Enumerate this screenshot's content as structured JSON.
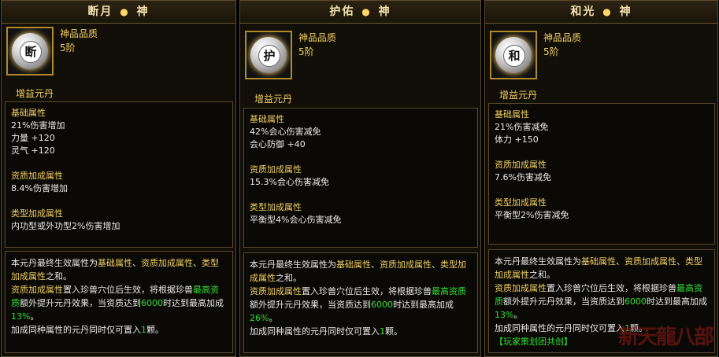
{
  "panels": [
    {
      "title_left": "断月",
      "title_dot": "●",
      "title_right": "神",
      "icon_glyph": "断",
      "quality_label": "神品品质",
      "stage": "5阶",
      "subtitle": "增益元丹",
      "base_header": "基础属性",
      "base_lines": [
        "21%伤害增加",
        "力量 +120",
        "灵气 +120"
      ],
      "aptitude_header": "资质加成属性",
      "aptitude_lines": [
        "8.4%伤害增加"
      ],
      "type_header": "类型加成属性",
      "type_lines": [
        "内功型或外功型2%伤害增加"
      ]
    },
    {
      "title_left": "护佑",
      "title_dot": "●",
      "title_right": "神",
      "icon_glyph": "护",
      "quality_label": "神品品质",
      "stage": "5阶",
      "subtitle": "增益元丹",
      "base_header": "基础属性",
      "base_lines": [
        "42%会心伤害减免",
        "会心防御 +40"
      ],
      "aptitude_header": "资质加成属性",
      "aptitude_lines": [
        "15.3%会心伤害减免"
      ],
      "type_header": "类型加成属性",
      "type_lines": [
        "平衡型4%会心伤害减免"
      ]
    },
    {
      "title_left": "和光",
      "title_dot": "●",
      "title_right": "神",
      "icon_glyph": "和",
      "quality_label": "神品品质",
      "stage": "5阶",
      "subtitle": "增益元丹",
      "base_header": "基础属性",
      "base_lines": [
        "21%伤害减免",
        "体力 +150"
      ],
      "aptitude_header": "资质加成属性",
      "aptitude_lines": [
        "7.6%伤害减免"
      ],
      "type_header": "类型加成属性",
      "type_lines": [
        "平衡型2%伤害减免"
      ]
    }
  ],
  "description": {
    "p1_a": "本元丹最终生效属性为",
    "p1_b": "基础属性",
    "p1_c": "、",
    "p1_d": "资质加成属性",
    "p1_e": "、",
    "p1_f": "类型加成属性",
    "p1_g": "之和。",
    "p2_a": "资质加成属性",
    "p2_b": "置入珍兽穴位后生效，将根据珍兽",
    "p2_c": "最高资质",
    "p2_d": "额外提升元丹效果，当资质达到",
    "p2_e": "6000",
    "p2_f": "时达到最高加成",
    "p2_rates": [
      "13%",
      "26%",
      "13%"
    ],
    "p2_g": "。",
    "p3_a": "加成同种属性的元丹同时仅可置入",
    "p3_b": "1",
    "p3_c": "颗。"
  },
  "credit": "【玩家策划团共创】",
  "watermark": "新天龍八部"
}
